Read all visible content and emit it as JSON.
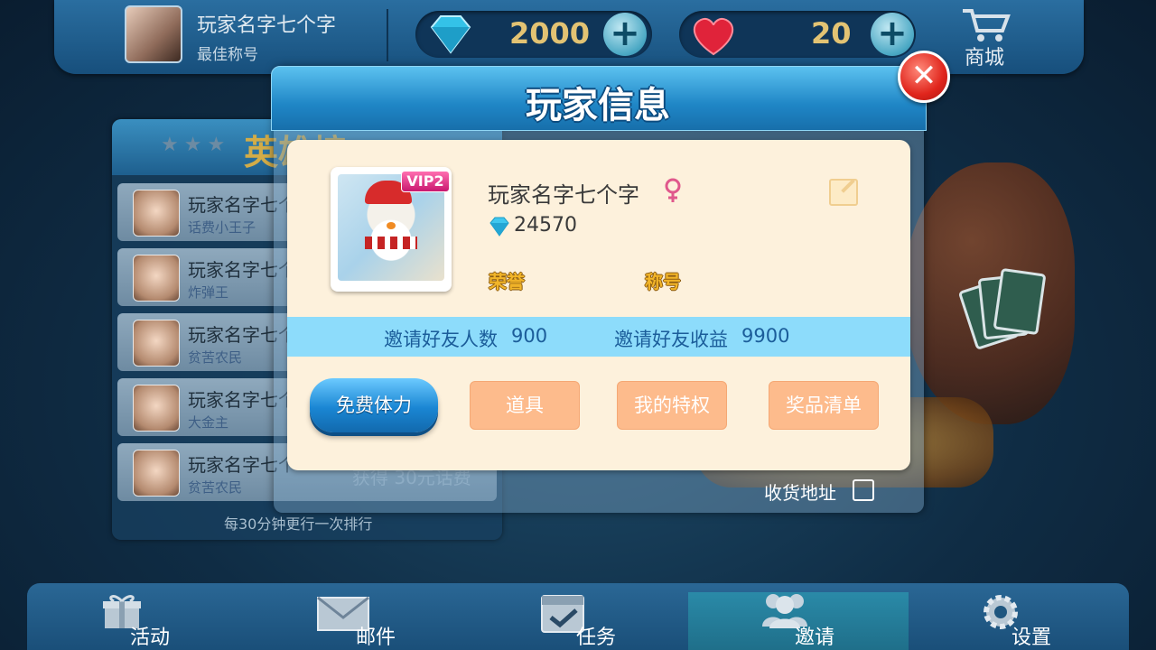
{
  "top_bar": {
    "player_name": "玩家名字七个字",
    "player_title": "最佳称号",
    "diamonds": "2000",
    "hearts": "20",
    "shop_label": "商城"
  },
  "leaderboard": {
    "title": "英雄榜",
    "rows": [
      {
        "name": "玩家名字七个",
        "sub": "话费小王子"
      },
      {
        "name": "玩家名字七个",
        "sub": "炸弹王"
      },
      {
        "name": "玩家名字七个",
        "sub": "贫苦农民"
      },
      {
        "name": "玩家名字七个",
        "sub": "大金主"
      },
      {
        "name": "玩家名字七个",
        "sub": "贫苦农民"
      }
    ],
    "prize_text": "获得 30元话费",
    "footer": "每30分钟更行一次排行"
  },
  "background": {
    "address_label": "收货地址"
  },
  "dialog": {
    "title": "玩家信息",
    "vip_badge": "VIP2",
    "player_name": "玩家名字七个字",
    "gems": "24570",
    "honor_label": "荣誉",
    "title_label": "称号",
    "invite_count_label": "邀请好友人数",
    "invite_count_value": "900",
    "invite_income_label": "邀请好友收益",
    "invite_income_value": "9900",
    "buttons": {
      "free_stamina": "免费体力",
      "items": "道具",
      "privileges": "我的特权",
      "prize_list": "奖品清单"
    }
  },
  "bottom_nav": {
    "items": [
      {
        "label": "活动",
        "icon": "gift-icon"
      },
      {
        "label": "邮件",
        "icon": "mail-icon"
      },
      {
        "label": "任务",
        "icon": "calendar-check-icon"
      },
      {
        "label": "邀请",
        "icon": "users-icon"
      },
      {
        "label": "设置",
        "icon": "gear-icon"
      }
    ],
    "active_index": 3
  },
  "colors": {
    "dialog_header": "#1f86c6",
    "card_bg": "#fdf1dc",
    "stats_strip": "#8ddcfb",
    "primary_button": "#1a86d3",
    "secondary_button": "#fdbb8c",
    "close_button": "#e0251c"
  }
}
